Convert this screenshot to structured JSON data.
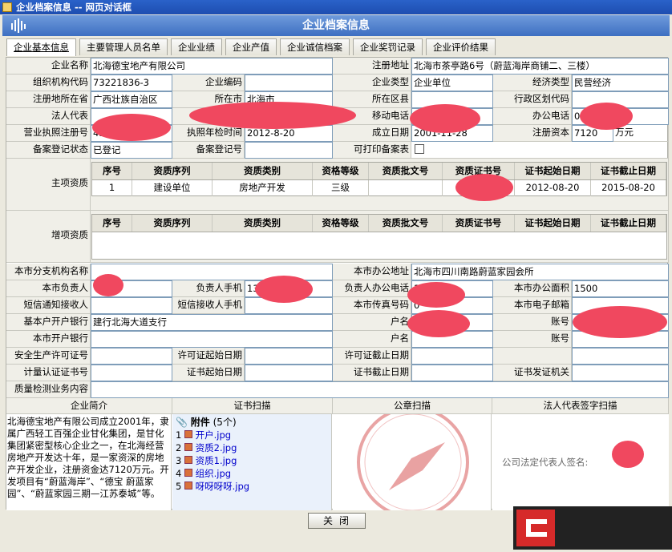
{
  "window_title": "企业档案信息 -- 网页对话框",
  "header_title": "企业档案信息",
  "tabs": [
    "企业基本信息",
    "主要管理人员名单",
    "企业业绩",
    "企业产值",
    "企业诚信档案",
    "企业奖罚记录",
    "企业评价结果"
  ],
  "f": {
    "name_l": "企业名称",
    "name_v": "北海德宝地产有限公司",
    "addr_l": "注册地址",
    "addr_v": "北海市茶亭路6号（蔚蓝海岸商铺二、三楼）",
    "org_l": "组织机构代码",
    "org_v": "73221836-3",
    "code_l": "企业编码",
    "code_v": "",
    "type_l": "企业类型",
    "type_v": "企业单位",
    "econ_l": "经济类型",
    "econ_v": "民营经济",
    "prov_l": "注册地所在省",
    "prov_v": "广西壮族自治区",
    "city_l": "所在市",
    "city_v": "北海市",
    "dist_l": "所在区县",
    "dist_v": "",
    "admin_l": "行政区划代码",
    "admin_v": "",
    "legal_l": "法人代表",
    "legal_v": "",
    "id_l": "身份证号",
    "id_v": "",
    "mobile_l": "移动电话",
    "mobile_v": "",
    "office_l": "办公电话",
    "office_v": "07",
    "lic_l": "营业执照注册号",
    "lic_v": "45",
    "annual_l": "执照年检时间",
    "annual_v": "2012-8-20",
    "est_l": "成立日期",
    "est_v": "2001-11-28",
    "cap_l": "注册资本",
    "cap_v": "7120",
    "cap_unit": "万元",
    "reg_l": "备案登记状态",
    "reg_v": "已登记",
    "regno_l": "备案登记号",
    "regno_v": "",
    "print_l": "可打印备案表",
    "main_q_l": "主项资质",
    "add_q_l": "增项资质",
    "branch_l": "本市分支机构名称",
    "branch_v": "",
    "baddr_l": "本市办公地址",
    "baddr_v": "北海市四川南路蔚蓝家园会所",
    "resp_l": "本市负责人",
    "resp_v": "",
    "rmob_l": "负责人手机",
    "rmob_v": "13",
    "rtel_l": "负责人办公电话",
    "rtel_v": "3",
    "area_l": "本市办公面积",
    "area_v": "1500",
    "sms_l": "短信通知接收人",
    "sms_v": "",
    "smsm_l": "短信接收人手机",
    "smsm_v": "",
    "fax_l": "本市传真号码",
    "fax_v": "0",
    "mail_l": "本市电子邮箱",
    "mail_v": "",
    "bank_l": "基本户开户银行",
    "bank_v": "建行北海大道支行",
    "acctname_l": "户名",
    "acctname_v": "有限公",
    "acct_l": "账号",
    "acct_v": "4",
    "bank2_l": "本市开户银行",
    "bank2_v": "",
    "acctname2_l": "户名",
    "acctname2_v": "",
    "acct2_l": "账号",
    "acct2_v": "",
    "safe_l": "安全生产许可证号",
    "safe_v": "",
    "pstart_l": "许可证起始日期",
    "pstart_v": "",
    "pend_l": "许可证截止日期",
    "pend_v": "",
    "meas_l": "计量认证证书号",
    "meas_v": "",
    "cstart_l": "证书起始日期",
    "cstart_v": "",
    "cend_l": "证书截止日期",
    "cend_v": "",
    "cissuer_l": "证书发证机关",
    "cissuer_v": "",
    "qc_l": "质量检测业务内容",
    "qc_v": ""
  },
  "qual_headers": [
    "序号",
    "资质序列",
    "资质类别",
    "资格等级",
    "资质批文号",
    "资质证书号",
    "证书起始日期",
    "证书截止日期"
  ],
  "qual_row": [
    "1",
    "建设单位",
    "房地产开发",
    "三级",
    "",
    "",
    "2012-08-20",
    "2015-08-20"
  ],
  "sec_headers": [
    "企业简介",
    "证书扫描",
    "公章扫描",
    "法人代表签字扫描"
  ],
  "intro": "北海德宝地产有限公司成立2001年，隶属广西轻工百强企业甘化集团，是甘化集团紧密型核心企业之一，在北海经营房地产开发达十年，是一家资深的房地产开发企业，注册资金达7120万元。开发项目有“蔚蓝海岸”、“德宝 蔚蓝家园”、“蔚蓝家园三期—江苏泰城”等。",
  "attach_label": "附件",
  "attach_count": "(5个)",
  "files": [
    {
      "n": "1",
      "name": "开户.jpg"
    },
    {
      "n": "2",
      "name": "资质2.jpg"
    },
    {
      "n": "3",
      "name": "资质1.jpg"
    },
    {
      "n": "4",
      "name": "组织.jpg"
    },
    {
      "n": "5",
      "name": "呀呀呀呀.jpg"
    }
  ],
  "sign_text": "公司法定代表人签名:",
  "close_label": "关闭",
  "colors": {
    "header": "#3d6fc2",
    "redact": "#f0485f",
    "link": "#0000cc"
  }
}
